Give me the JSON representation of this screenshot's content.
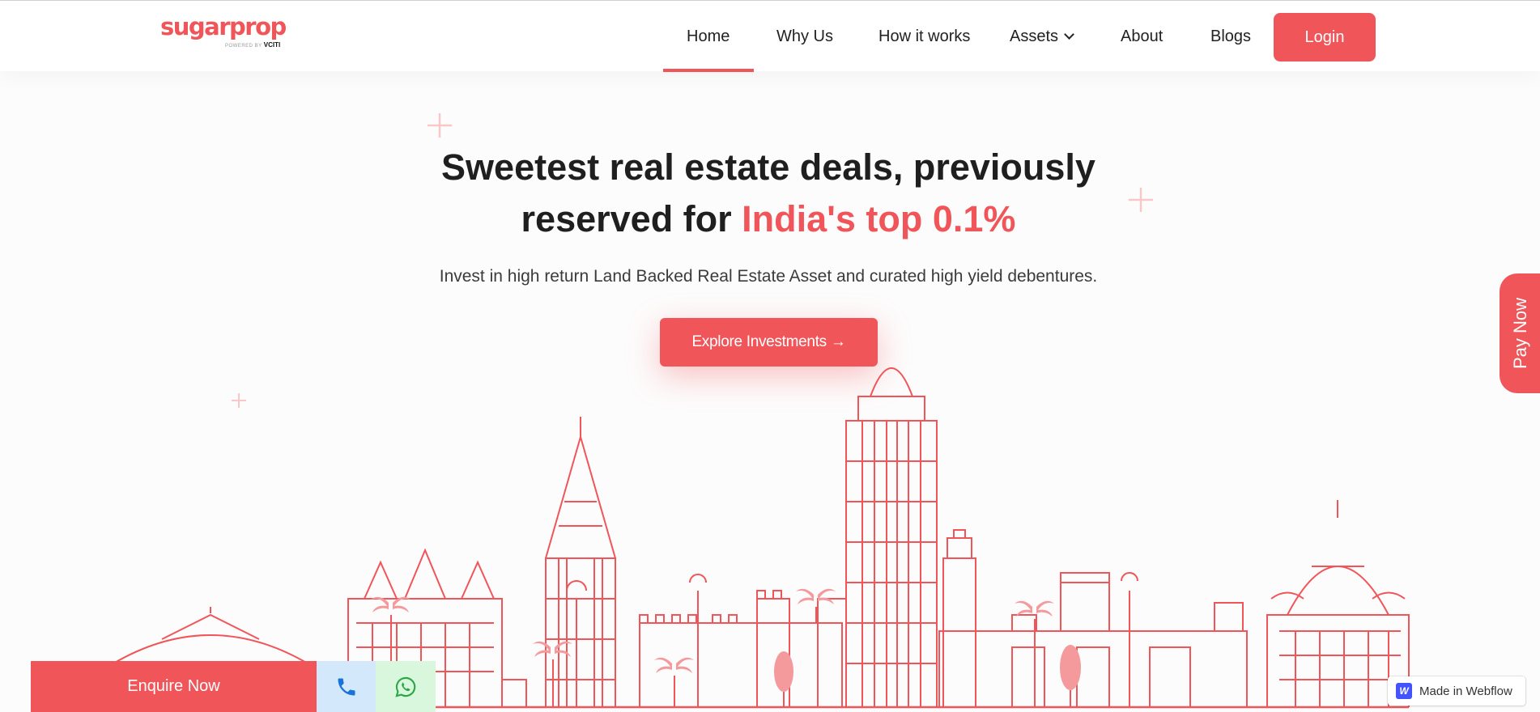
{
  "brand": {
    "name": "sugarprop",
    "powered_by": "POWERED BY",
    "partner": "VCITI",
    "accent": "#f0555a"
  },
  "nav": {
    "items": [
      {
        "label": "Home",
        "active": true
      },
      {
        "label": "Why Us"
      },
      {
        "label": "How it works"
      },
      {
        "label": "Assets",
        "dropdown": true
      },
      {
        "label": "About"
      },
      {
        "label": "Blogs"
      }
    ],
    "login_label": "Login"
  },
  "hero": {
    "title_line1": "Sweetest real estate deals, previously",
    "title_line2_prefix": "reserved for ",
    "title_highlight": "India's top 0.1%",
    "subtitle": "Invest in high return Land Backed Real Estate Asset and curated high yield debentures.",
    "cta_label": "Explore Investments →"
  },
  "side_tab": {
    "label": "Pay Now"
  },
  "bottom_bar": {
    "enquire_label": "Enquire Now",
    "phone_icon": "phone-icon",
    "whatsapp_icon": "whatsapp-icon"
  },
  "badge": {
    "label": "Made in Webflow",
    "logo_letter": "W"
  }
}
